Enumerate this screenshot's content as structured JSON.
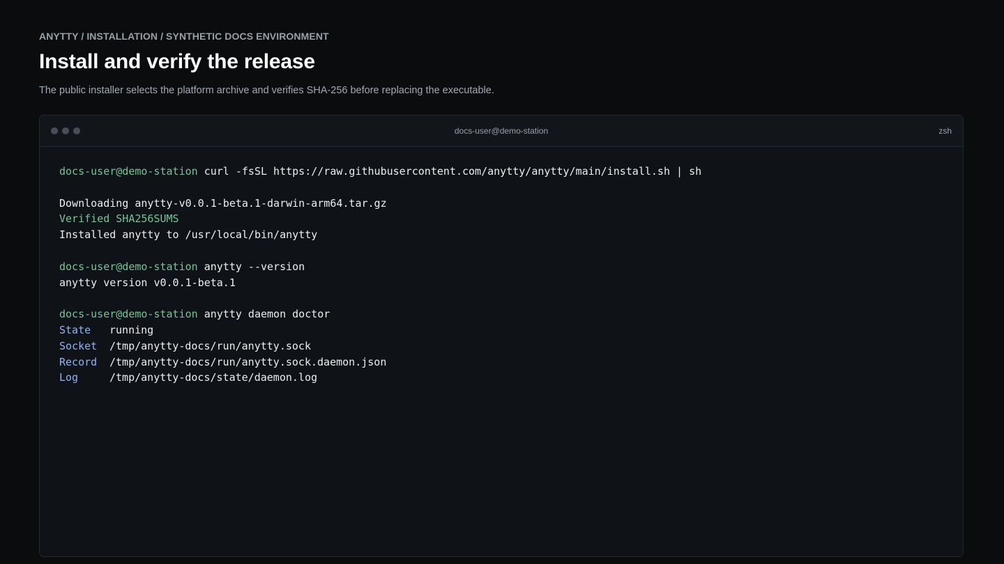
{
  "breadcrumb": "ANYTTY / INSTALLATION / SYNTHETIC DOCS ENVIRONMENT",
  "title": "Install and verify the release",
  "subtitle": "The public installer selects the platform archive and verifies SHA-256 before replacing the executable.",
  "terminal": {
    "window_title": "docs-user@demo-station",
    "shell": "zsh",
    "prompt": "docs-user@demo-station",
    "blocks": {
      "install": {
        "command": "curl -fsSL https://raw.githubusercontent.com/anytty/anytty/main/install.sh | sh",
        "downloading": "Downloading anytty-v0.0.1-beta.1-darwin-arm64.tar.gz",
        "verified": "Verified SHA256SUMS",
        "installed": "Installed anytty to /usr/local/bin/anytty"
      },
      "version": {
        "command": "anytty --version",
        "output": "anytty version v0.0.1-beta.1"
      },
      "doctor": {
        "command": "anytty daemon doctor",
        "rows": [
          {
            "key": "State",
            "value": "running"
          },
          {
            "key": "Socket",
            "value": "/tmp/anytty-docs/run/anytty.sock"
          },
          {
            "key": "Record",
            "value": "/tmp/anytty-docs/run/anytty.sock.daemon.json"
          },
          {
            "key": "Log",
            "value": "/tmp/anytty-docs/state/daemon.log"
          }
        ]
      }
    }
  },
  "colors": {
    "background": "#0b0c0e",
    "terminal_bg": "#0f1217",
    "prompt": "#79c29a",
    "success": "#79c29a",
    "key": "#8fb3f5",
    "text": "#eceef1"
  },
  "icons": [
    "window-dot-icon",
    "window-dot-icon",
    "window-dot-icon"
  ]
}
